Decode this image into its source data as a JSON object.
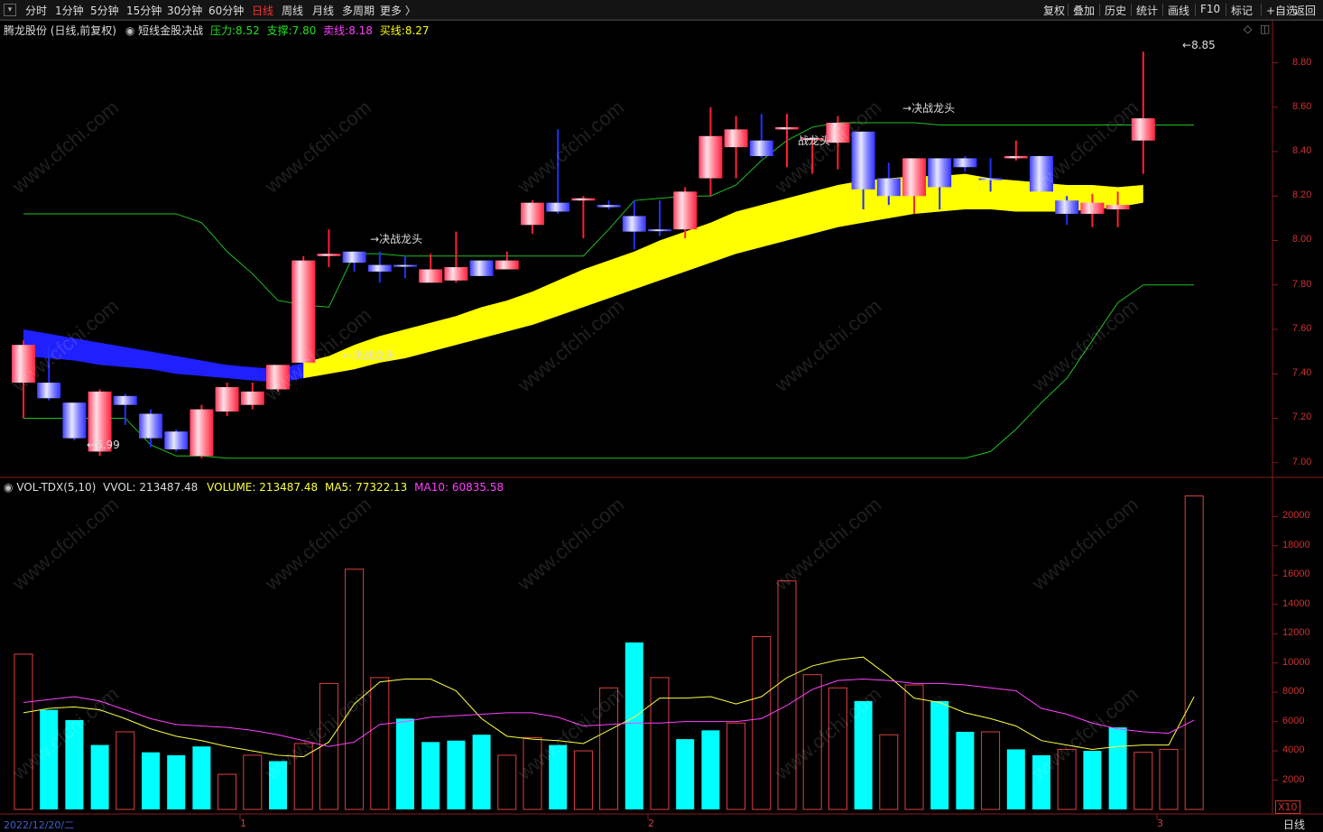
{
  "toolbar": {
    "menu_icon": "menu-icon",
    "periods": [
      "分时",
      "1分钟",
      "5分钟",
      "15分钟",
      "30分钟",
      "60分钟",
      "日线",
      "周线",
      "月线",
      "多周期",
      "更多 〉"
    ],
    "active_period": "日线",
    "right_buttons": [
      "复权",
      "叠加",
      "历史",
      "统计",
      "画线",
      "F10",
      "标记",
      "+自选",
      "返回"
    ]
  },
  "chart_header": {
    "stock_name": "腾龙股份 (日线,前复权)",
    "indicator_name": "短线金股决战",
    "pressure_label": "压力:",
    "pressure_value": "8.52",
    "support_label": "支撑:",
    "support_value": "7.80",
    "sell_label": "卖线:",
    "sell_value": "8.18",
    "buy_label": "买线:",
    "buy_value": "8.27",
    "colors": {
      "pressure": "#ff2020",
      "support": "#20ff20",
      "sell": "#ff40ff",
      "buy": "#ffff00"
    }
  },
  "price_axis": [
    "8.80",
    "8.60",
    "8.40",
    "8.20",
    "8.00",
    "7.80",
    "7.60",
    "7.40",
    "7.20",
    "7.00"
  ],
  "annotations": {
    "high_label": "8.85",
    "low_label": "6.99",
    "signal_labels": [
      "决战龙头",
      "决战龙头",
      "战龙头",
      "决战龙头"
    ]
  },
  "volume_header": {
    "name": "VOL-TDX(5,10)",
    "vvol_label": "VVOL:",
    "vvol_value": "213487.48",
    "volume_label": "VOLUME:",
    "volume_value": "213487.48",
    "ma5_label": "MA5:",
    "ma5_value": "77322.13",
    "ma10_label": "MA10:",
    "ma10_value": "60835.58"
  },
  "volume_axis": [
    "20000",
    "18000",
    "16000",
    "14000",
    "12000",
    "10000",
    "8000",
    "6000",
    "4000",
    "2000"
  ],
  "volume_unit": "X10",
  "bottom_bar": {
    "start_date": "2022/12/20/二",
    "month_marks": [
      "1",
      "2",
      "3"
    ],
    "period_label": "日线"
  },
  "watermark": "www.cfchi.com",
  "chart_data": {
    "type": "candlestick",
    "price_ylim": [
      6.95,
      8.92
    ],
    "volume_ylim": [
      0,
      21500
    ],
    "candles": [
      {
        "o": 7.53,
        "h": 7.55,
        "l": 7.2,
        "c": 7.36,
        "up": true
      },
      {
        "o": 7.29,
        "h": 7.53,
        "l": 7.28,
        "c": 7.36,
        "up": false
      },
      {
        "o": 7.27,
        "h": 7.27,
        "l": 7.1,
        "c": 7.11,
        "up": false
      },
      {
        "o": 7.05,
        "h": 7.33,
        "l": 7.03,
        "c": 7.32,
        "up": true
      },
      {
        "o": 7.26,
        "h": 7.31,
        "l": 7.17,
        "c": 7.3,
        "up": false
      },
      {
        "o": 7.11,
        "h": 7.24,
        "l": 7.07,
        "c": 7.22,
        "up": false
      },
      {
        "o": 7.06,
        "h": 7.15,
        "l": 7.05,
        "c": 7.14,
        "up": false
      },
      {
        "o": 7.03,
        "h": 7.26,
        "l": 7.02,
        "c": 7.24,
        "up": true
      },
      {
        "o": 7.23,
        "h": 7.36,
        "l": 7.21,
        "c": 7.34,
        "up": true
      },
      {
        "o": 7.26,
        "h": 7.36,
        "l": 7.24,
        "c": 7.32,
        "up": true
      },
      {
        "o": 7.33,
        "h": 7.44,
        "l": 7.32,
        "c": 7.44,
        "up": true
      },
      {
        "o": 7.45,
        "h": 7.93,
        "l": 7.45,
        "c": 7.91,
        "up": true
      },
      {
        "o": 7.94,
        "h": 8.05,
        "l": 7.88,
        "c": 7.93,
        "up": true
      },
      {
        "o": 7.95,
        "h": 7.95,
        "l": 7.86,
        "c": 7.9,
        "up": false
      },
      {
        "o": 7.89,
        "h": 7.95,
        "l": 7.81,
        "c": 7.86,
        "up": false
      },
      {
        "o": 7.89,
        "h": 7.93,
        "l": 7.83,
        "c": 7.89,
        "up": false
      },
      {
        "o": 7.87,
        "h": 7.94,
        "l": 7.81,
        "c": 7.81,
        "up": true
      },
      {
        "o": 7.88,
        "h": 8.04,
        "l": 7.81,
        "c": 7.82,
        "up": true
      },
      {
        "o": 7.91,
        "h": 7.91,
        "l": 7.84,
        "c": 7.84,
        "up": false
      },
      {
        "o": 7.87,
        "h": 7.95,
        "l": 7.87,
        "c": 7.91,
        "up": true
      },
      {
        "o": 8.07,
        "h": 8.18,
        "l": 8.03,
        "c": 8.17,
        "up": true
      },
      {
        "o": 8.17,
        "h": 8.5,
        "l": 8.12,
        "c": 8.13,
        "up": false
      },
      {
        "o": 8.18,
        "h": 8.2,
        "l": 8.01,
        "c": 8.19,
        "up": true
      },
      {
        "o": 8.15,
        "h": 8.18,
        "l": 8.14,
        "c": 8.16,
        "up": false
      },
      {
        "o": 8.11,
        "h": 8.18,
        "l": 7.96,
        "c": 8.04,
        "up": false
      },
      {
        "o": 8.05,
        "h": 8.18,
        "l": 8.02,
        "c": 8.05,
        "up": false
      },
      {
        "o": 8.05,
        "h": 8.24,
        "l": 8.01,
        "c": 8.22,
        "up": true
      },
      {
        "o": 8.28,
        "h": 8.6,
        "l": 8.2,
        "c": 8.47,
        "up": true
      },
      {
        "o": 8.42,
        "h": 8.56,
        "l": 8.28,
        "c": 8.5,
        "up": true
      },
      {
        "o": 8.45,
        "h": 8.57,
        "l": 8.37,
        "c": 8.38,
        "up": false
      },
      {
        "o": 8.5,
        "h": 8.57,
        "l": 8.33,
        "c": 8.51,
        "up": true
      },
      {
        "o": 8.46,
        "h": 8.46,
        "l": 8.3,
        "c": 8.46,
        "up": true
      },
      {
        "o": 8.53,
        "h": 8.56,
        "l": 8.32,
        "c": 8.44,
        "up": true
      },
      {
        "o": 8.49,
        "h": 8.49,
        "l": 8.14,
        "c": 8.23,
        "up": false
      },
      {
        "o": 8.28,
        "h": 8.35,
        "l": 8.16,
        "c": 8.2,
        "up": false
      },
      {
        "o": 8.2,
        "h": 8.37,
        "l": 8.12,
        "c": 8.37,
        "up": true
      },
      {
        "o": 8.37,
        "h": 8.37,
        "l": 8.14,
        "c": 8.24,
        "up": false
      },
      {
        "o": 8.37,
        "h": 8.38,
        "l": 8.31,
        "c": 8.33,
        "up": false
      },
      {
        "o": 8.28,
        "h": 8.37,
        "l": 8.22,
        "c": 8.28,
        "up": false
      },
      {
        "o": 8.37,
        "h": 8.45,
        "l": 8.36,
        "c": 8.38,
        "up": true
      },
      {
        "o": 8.38,
        "h": 8.38,
        "l": 8.22,
        "c": 8.22,
        "up": false
      },
      {
        "o": 8.18,
        "h": 8.2,
        "l": 8.07,
        "c": 8.12,
        "up": false
      },
      {
        "o": 8.12,
        "h": 8.21,
        "l": 8.06,
        "c": 8.17,
        "up": true
      },
      {
        "o": 8.16,
        "h": 8.22,
        "l": 8.06,
        "c": 8.14,
        "up": true
      },
      {
        "o": 8.45,
        "h": 8.85,
        "l": 8.3,
        "c": 8.55,
        "up": true
      }
    ],
    "volumes": [
      10600,
      6800,
      6100,
      4400,
      5300,
      3900,
      3700,
      4300,
      2400,
      3700,
      3300,
      4500,
      8600,
      16400,
      9000,
      6200,
      4600,
      4700,
      5100,
      3700,
      4900,
      4400,
      4000,
      8300,
      11400,
      9000,
      4800,
      5400,
      5900,
      11800,
      15600,
      9200,
      8300,
      7400,
      5100,
      8500,
      7400,
      5300,
      5300,
      4100,
      3700,
      4100,
      4000,
      5600,
      3900,
      4100,
      21400
    ],
    "volume_up": [
      true,
      false,
      false,
      false,
      true,
      false,
      false,
      false,
      true,
      true,
      false,
      true,
      true,
      true,
      true,
      false,
      false,
      false,
      false,
      true,
      true,
      false,
      true,
      true,
      false,
      true,
      false,
      false,
      true,
      true,
      true,
      true,
      true,
      false,
      true,
      true,
      false,
      false,
      true,
      false,
      false,
      true,
      false,
      false,
      true,
      true,
      true
    ],
    "ma5": [
      6600,
      6900,
      7000,
      6800,
      6200,
      5500,
      5000,
      4700,
      4300,
      4000,
      3700,
      3600,
      4600,
      7200,
      8700,
      8900,
      8900,
      8100,
      6200,
      5000,
      4800,
      4700,
      4500,
      5400,
      6300,
      7600,
      7600,
      7700,
      7200,
      7700,
      9000,
      9800,
      10200,
      10400,
      9100,
      7600,
      7300,
      6600,
      6200,
      5700,
      4700,
      4400,
      4100,
      4300,
      4400,
      4400,
      7700
    ],
    "ma10": [
      7300,
      7500,
      7700,
      7400,
      6800,
      6200,
      5800,
      5700,
      5600,
      5400,
      5100,
      4700,
      4300,
      4600,
      5800,
      6000,
      6300,
      6400,
      6500,
      6600,
      6600,
      6300,
      5700,
      5800,
      5900,
      5900,
      6000,
      6000,
      6000,
      6200,
      7100,
      8200,
      8800,
      8900,
      8800,
      8600,
      8600,
      8500,
      8300,
      8100,
      6900,
      6500,
      5900,
      5500,
      5300,
      5200,
      6100
    ],
    "support_line": [
      7.8,
      7.8,
      7.8,
      7.8,
      7.8,
      7.8,
      7.8,
      7.8,
      7.8,
      7.8,
      7.8,
      7.8,
      7.8,
      7.8,
      7.8,
      7.8,
      7.8,
      7.8,
      7.8,
      7.8,
      7.8,
      7.8,
      7.8,
      7.8,
      7.8,
      7.8,
      7.8,
      7.8,
      7.8,
      7.8,
      7.8,
      7.8,
      7.8,
      7.8,
      7.8,
      7.8,
      7.8,
      7.8,
      7.8,
      7.8,
      7.8,
      7.8,
      7.8,
      7.8,
      7.8,
      7.8,
      7.8
    ],
    "band_top": [
      7.6,
      7.58,
      7.56,
      7.54,
      7.52,
      7.5,
      7.48,
      7.46,
      7.44,
      7.43,
      7.42,
      7.45,
      7.48,
      7.53,
      7.57,
      7.6,
      7.63,
      7.66,
      7.7,
      7.73,
      7.77,
      7.82,
      7.87,
      7.91,
      7.95,
      8.0,
      8.04,
      8.08,
      8.13,
      8.16,
      8.19,
      8.22,
      8.25,
      8.27,
      8.28,
      8.29,
      8.29,
      8.3,
      8.28,
      8.27,
      8.26,
      8.25,
      8.25,
      8.24,
      8.25,
      8.26,
      8.27
    ],
    "band_bottom": [
      7.48,
      7.47,
      7.46,
      7.44,
      7.43,
      7.42,
      7.4,
      7.39,
      7.38,
      7.37,
      7.36,
      7.38,
      7.4,
      7.42,
      7.45,
      7.47,
      7.5,
      7.53,
      7.56,
      7.59,
      7.62,
      7.66,
      7.7,
      7.74,
      7.78,
      7.82,
      7.86,
      7.9,
      7.94,
      7.97,
      8.0,
      8.03,
      8.06,
      8.08,
      8.1,
      8.12,
      8.13,
      8.14,
      8.14,
      8.13,
      8.13,
      8.13,
      8.14,
      8.15,
      8.17,
      8.18,
      8.18
    ],
    "pressure_line": [
      8.12,
      8.12,
      8.12,
      8.12,
      8.12,
      8.12,
      8.12,
      8.08,
      7.95,
      7.85,
      7.73,
      7.71,
      7.7,
      7.94,
      7.94,
      7.93,
      7.93,
      7.93,
      7.93,
      7.93,
      7.93,
      7.93,
      7.93,
      8.05,
      8.18,
      8.19,
      8.2,
      8.2,
      8.25,
      8.36,
      8.45,
      8.51,
      8.53,
      8.53,
      8.53,
      8.53,
      8.52,
      8.52,
      8.52,
      8.52,
      8.52,
      8.52,
      8.52,
      8.52,
      8.52,
      8.52,
      8.52
    ],
    "lower_line": [
      7.2,
      7.2,
      7.2,
      7.2,
      7.2,
      7.08,
      7.03,
      7.03,
      7.02,
      7.02,
      7.02,
      7.02,
      7.02,
      7.02,
      7.02,
      7.02,
      7.02,
      7.02,
      7.02,
      7.02,
      7.02,
      7.02,
      7.02,
      7.02,
      7.02,
      7.02,
      7.02,
      7.02,
      7.02,
      7.02,
      7.02,
      7.02,
      7.02,
      7.02,
      7.02,
      7.02,
      7.02,
      7.02,
      7.05,
      7.15,
      7.27,
      7.38,
      7.55,
      7.72,
      7.8,
      7.8,
      7.8
    ]
  }
}
